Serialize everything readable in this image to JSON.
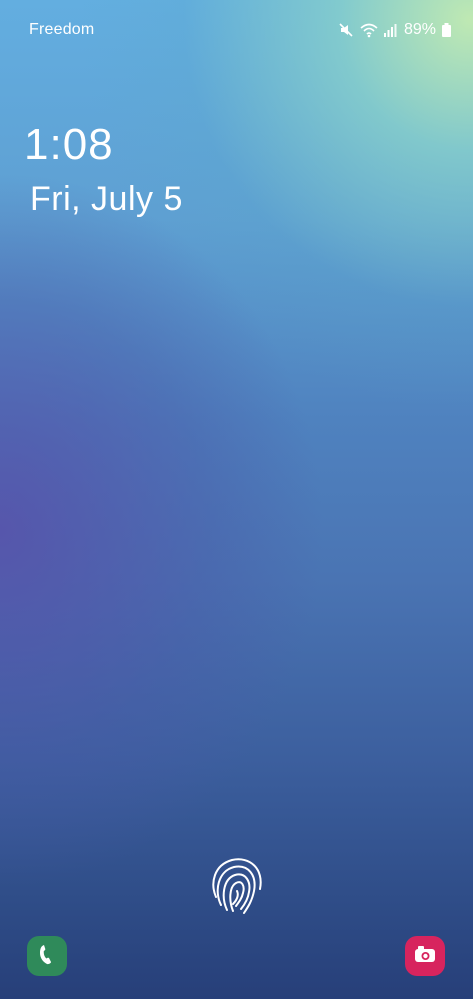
{
  "status_bar": {
    "carrier": "Freedom",
    "battery_percent": "89%",
    "icons": [
      "mute-icon",
      "wifi-icon",
      "signal-icon",
      "battery-icon"
    ]
  },
  "lockscreen": {
    "time": "1:08",
    "date": "Fri, July 5"
  },
  "fingerprint": {
    "icon": "fingerprint-icon"
  },
  "shortcuts": [
    {
      "name": "phone",
      "icon": "phone-icon",
      "color": "#2f8a5a"
    },
    {
      "name": "camera",
      "icon": "camera-icon",
      "color": "#d7245e"
    }
  ]
}
